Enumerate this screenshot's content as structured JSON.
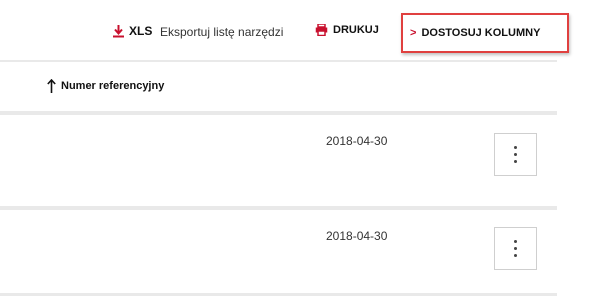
{
  "toolbar": {
    "xls_label": "XLS",
    "export_label": "Eksportuj listę narzędzi",
    "print_label": "DRUKUJ",
    "columns_label": "DOSTOSUJ KOLUMNY",
    "accent_color": "#c8102e",
    "highlight_color": "#e0403f",
    "icons": {
      "xls": "download-icon",
      "print": "printer-icon",
      "columns": "chevron-right-icon"
    }
  },
  "table": {
    "sort_column_label": "Numer referencyjny",
    "sort_direction": "ascending",
    "rows": [
      {
        "date": "2018-04-30",
        "actions_icon": "kebab-menu-icon"
      },
      {
        "date": "2018-04-30",
        "actions_icon": "kebab-menu-icon"
      }
    ]
  }
}
